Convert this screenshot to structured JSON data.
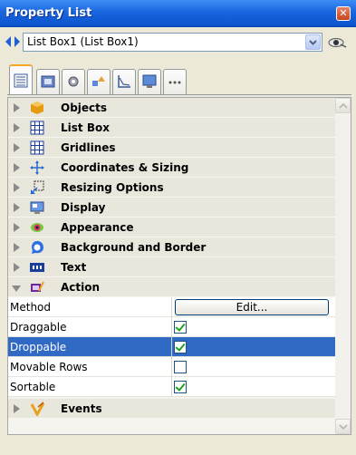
{
  "window": {
    "title": "Property List"
  },
  "object_selector": {
    "value": "List Box1 (List Box1)"
  },
  "tabs": [
    {
      "name": "properties-tab-icon",
      "active": true
    },
    {
      "name": "form-tab-icon",
      "active": false
    },
    {
      "name": "settings-tab-icon",
      "active": false
    },
    {
      "name": "shapes-tab-icon",
      "active": false
    },
    {
      "name": "graph-tab-icon",
      "active": false
    },
    {
      "name": "monitor-tab-icon",
      "active": false
    },
    {
      "name": "more-tab-icon",
      "active": false
    }
  ],
  "groups": [
    {
      "label": "Objects",
      "icon": "objects-icon",
      "expanded": false
    },
    {
      "label": "List Box",
      "icon": "list-box-icon",
      "expanded": false
    },
    {
      "label": "Gridlines",
      "icon": "gridlines-icon",
      "expanded": false
    },
    {
      "label": "Coordinates & Sizing",
      "icon": "coordinates-icon",
      "expanded": false
    },
    {
      "label": "Resizing Options",
      "icon": "resizing-icon",
      "expanded": false
    },
    {
      "label": "Display",
      "icon": "display-icon",
      "expanded": false
    },
    {
      "label": "Appearance",
      "icon": "appearance-icon",
      "expanded": false
    },
    {
      "label": "Background and Border",
      "icon": "background-border-icon",
      "expanded": false
    },
    {
      "label": "Text",
      "icon": "text-icon",
      "expanded": false
    },
    {
      "label": "Action",
      "icon": "action-icon",
      "expanded": true
    }
  ],
  "action_properties": [
    {
      "label": "Method",
      "type": "button",
      "value": "Edit..."
    },
    {
      "label": "Draggable",
      "type": "checkbox",
      "checked": true
    },
    {
      "label": "Droppable",
      "type": "checkbox",
      "checked": true,
      "selected": true
    },
    {
      "label": "Movable Rows",
      "type": "checkbox",
      "checked": false
    },
    {
      "label": "Sortable",
      "type": "checkbox",
      "checked": true
    }
  ],
  "events_group": {
    "label": "Events",
    "icon": "events-icon",
    "expanded": false
  },
  "colors": {
    "title_bar": "#1a66e0",
    "selection": "#316ac5",
    "group_background": "#e9e7dc",
    "check": "#21a121"
  }
}
